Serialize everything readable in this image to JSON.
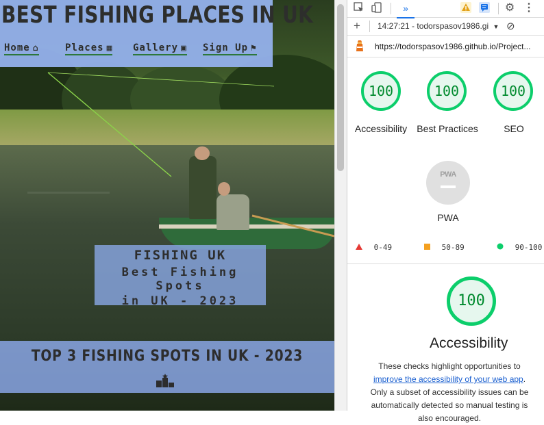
{
  "site": {
    "title": "BEST FISHING PLACES IN UK",
    "nav": [
      {
        "label": "Home",
        "icon": "home-icon",
        "glyph": "⌂"
      },
      {
        "label": "Places",
        "icon": "map-icon",
        "glyph": "▦"
      },
      {
        "label": "Gallery",
        "icon": "images-icon",
        "glyph": "▣"
      },
      {
        "label": "Sign Up",
        "icon": "flag-icon",
        "glyph": "⚑"
      }
    ],
    "banner": {
      "line1": "FISHING UK",
      "line2": "Best Fishing Spots",
      "line3": "in UK - 2023"
    },
    "section_title": "TOP 3 FISHING SPOTS IN UK - 2023",
    "section_icon": "podium-icon"
  },
  "devtools": {
    "toolbar": {
      "more_tabs": "»",
      "warning_icon": "warning-icon",
      "messages_icon": "messages-icon",
      "settings_icon": "gear-icon",
      "menu_icon": "kebab-menu-icon"
    },
    "report_bar": {
      "add": "+",
      "report_label": "14:27:21 - todorspasov1986.gi",
      "dropdown": "▼",
      "clear": "⊘"
    },
    "url": "https://todorspasov1986.github.io/Project...",
    "scores": [
      {
        "label": "Accessibility",
        "value": "100"
      },
      {
        "label": "Best Practices",
        "value": "100"
      },
      {
        "label": "SEO",
        "value": "100"
      }
    ],
    "pwa": {
      "badge": "PWA",
      "label": "PWA"
    },
    "legend": [
      {
        "range": "0-49",
        "color": "#e53935",
        "shape": "triangle"
      },
      {
        "range": "50-89",
        "color": "#f4a020",
        "shape": "square"
      },
      {
        "range": "90-100",
        "color": "#0cce6b",
        "shape": "circle"
      }
    ],
    "detail": {
      "score": "100",
      "title": "Accessibility",
      "desc_prefix": "These checks highlight opportunities to ",
      "desc_link": "improve the accessibility of your web app",
      "desc_suffix": ". Only a subset of accessibility issues can be automatically detected so manual testing is also encouraged."
    },
    "colors": {
      "pass": "#0cce6b",
      "link": "#1a5fd0",
      "accent": "#1a73e8"
    }
  }
}
